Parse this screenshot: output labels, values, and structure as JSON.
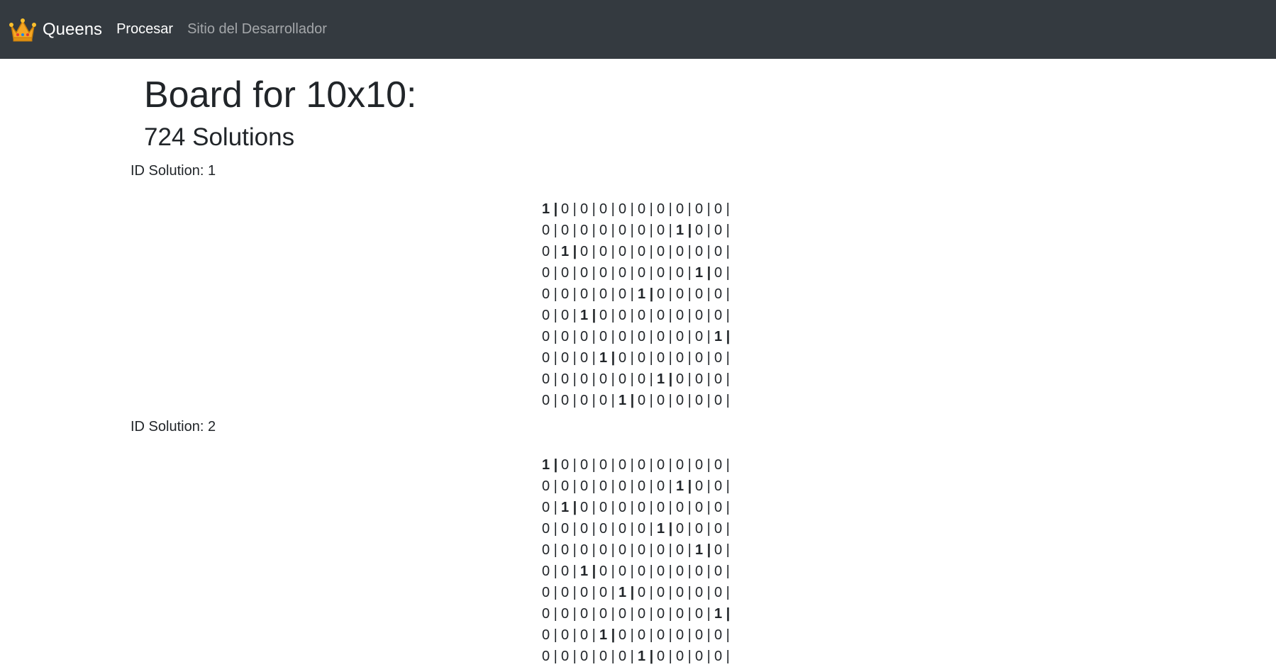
{
  "navbar": {
    "brand": "Queens",
    "brand_icon": "crown-icon",
    "links": [
      {
        "label": "Procesar",
        "active": true
      },
      {
        "label": "Sitio del Desarrollador",
        "active": false
      }
    ],
    "background": "#343a40"
  },
  "page": {
    "title": "Board for 10x10:",
    "subtitle": "724 Solutions"
  },
  "solutions": [
    {
      "label": "ID Solution: 1",
      "queen_columns": [
        0,
        7,
        1,
        8,
        5,
        2,
        9,
        3,
        6,
        4
      ]
    },
    {
      "label": "ID Solution: 2",
      "queen_columns": [
        0,
        7,
        1,
        6,
        8,
        2,
        4,
        9,
        3,
        5
      ]
    }
  ],
  "board": {
    "size": 10,
    "empty_symbol": "0",
    "queen_symbol": "1",
    "separator": "|"
  }
}
